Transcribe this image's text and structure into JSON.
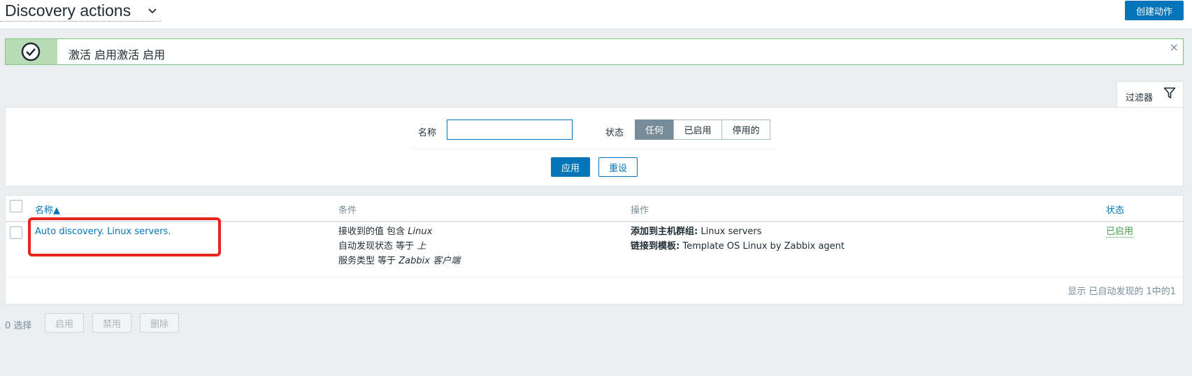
{
  "header": {
    "title": "Discovery actions",
    "create_label": "创建动作"
  },
  "message": {
    "text": "激活 启用激活 启用",
    "close": "×"
  },
  "filter": {
    "tab_label": "过滤器",
    "name_label": "名称",
    "name_value": "",
    "status_label": "状态",
    "status_options": [
      "任何",
      "已启用",
      "停用的"
    ],
    "status_selected": "任何",
    "apply_label": "应用",
    "reset_label": "重设"
  },
  "table": {
    "columns": [
      "名称▲",
      "条件",
      "操作",
      "状态"
    ],
    "rows": [
      {
        "name": "Auto discovery. Linux servers.",
        "conditions": [
          {
            "text": "接收到的值 包含 ",
            "value": "Linux"
          },
          {
            "text": "自动发现状态 等于 ",
            "value": "上"
          },
          {
            "text": "服务类型 等于 ",
            "value": "Zabbix 客户端"
          }
        ],
        "operations": [
          {
            "label": "添加到主机群组:",
            "value": " Linux servers"
          },
          {
            "label": "链接到模板:",
            "value": " Template OS Linux by Zabbix agent"
          }
        ],
        "status": "已启用"
      }
    ],
    "paging": "显示 已自动发现的 1中的1"
  },
  "footer": {
    "selected": "0 选择",
    "enable_label": "启用",
    "disable_label": "禁用",
    "delete_label": "删除"
  },
  "colors": {
    "accent": "#0275b8",
    "success": "#429e47",
    "annotation": "#e8231b"
  }
}
